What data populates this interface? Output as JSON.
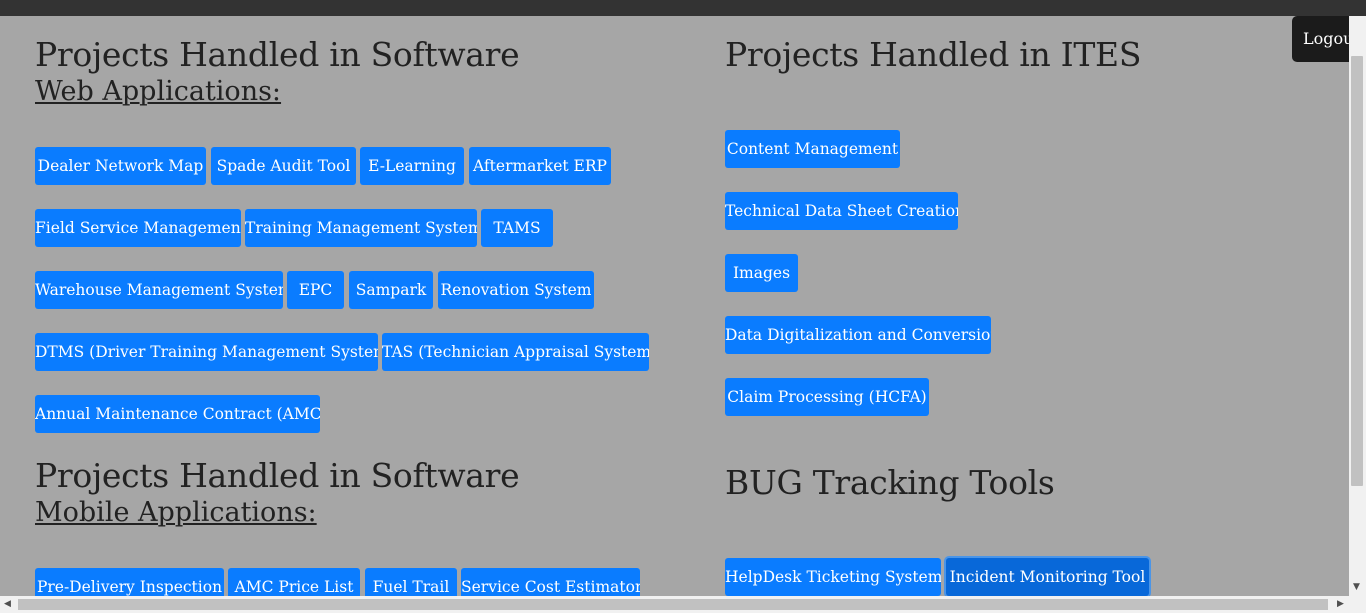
{
  "header": {
    "logout_label": "Logout"
  },
  "software_web": {
    "title": "Projects Handled in Software",
    "subtitle": "Web Applications:",
    "buttons": [
      "Dealer Network Map",
      "Spade Audit Tool",
      "E-Learning",
      "Aftermarket ERP",
      "Field Service Management",
      "Training Management System",
      "TAMS",
      "Warehouse Management System",
      "EPC",
      "Sampark",
      "Renovation System",
      "DTMS (Driver Training Management System)",
      "TAS (Technician Appraisal System)",
      "Annual Maintenance Contract (AMC)"
    ]
  },
  "software_mobile": {
    "title": "Projects Handled in Software",
    "subtitle": "Mobile Applications:",
    "buttons": [
      "Pre-Delivery Inspection",
      "AMC Price List",
      "Fuel Trail",
      "Service Cost Estimator"
    ]
  },
  "ites": {
    "title": "Projects Handled in ITES",
    "buttons": [
      "Content Management",
      "Technical Data Sheet Creation",
      "Images",
      "Data Digitalization and Conversion",
      "Claim Processing (HCFA)"
    ]
  },
  "bug_tools": {
    "title": "BUG Tracking Tools",
    "buttons": [
      "HelpDesk Ticketing System",
      "Incident Monitoring Tool"
    ]
  },
  "colors": {
    "button_bg": "#0a7cff",
    "page_bg": "#a6a6a6",
    "topbar": "#333333"
  }
}
